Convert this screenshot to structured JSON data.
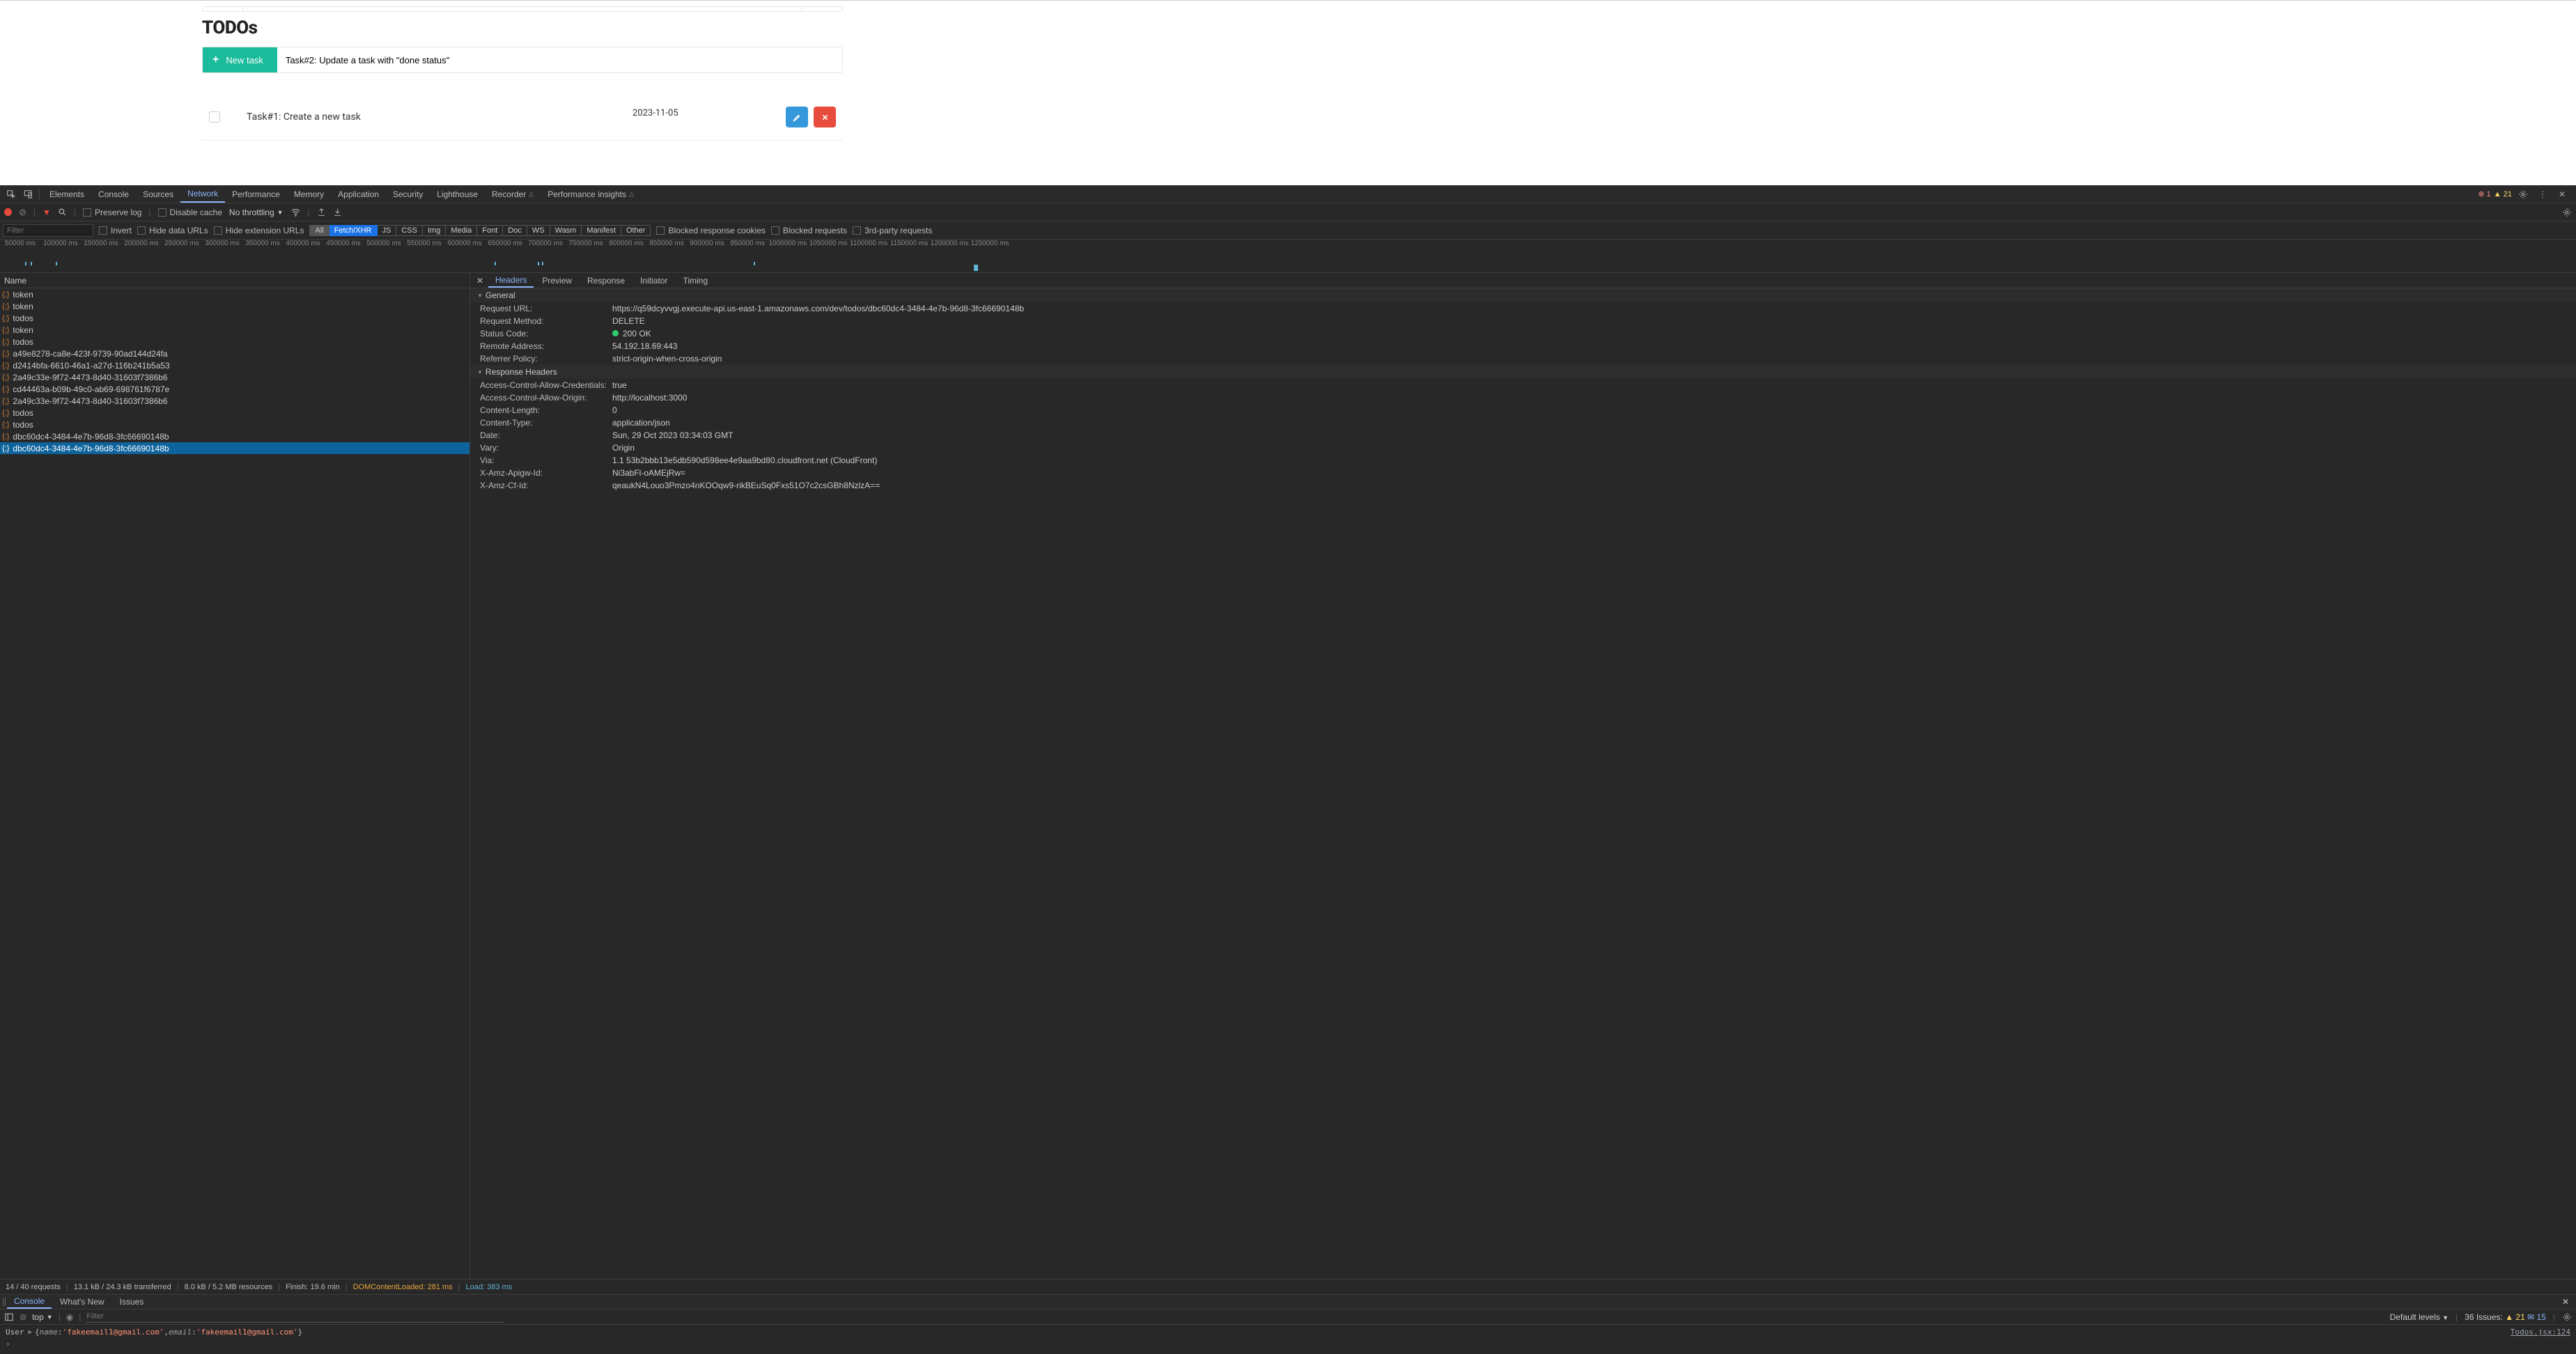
{
  "app": {
    "heading": "TODOs",
    "newTaskButton": "New task",
    "newTaskInput": "Task#2: Update a task with \"done status\"",
    "item": {
      "label": "Task#1: Create a new task",
      "date": "2023-11-05"
    }
  },
  "devtools": {
    "tabs": [
      "Elements",
      "Console",
      "Sources",
      "Network",
      "Performance",
      "Memory",
      "Application",
      "Security",
      "Lighthouse",
      "Recorder",
      "Performance insights"
    ],
    "activeTab": "Network",
    "errors": "1",
    "warnings": "21",
    "toolbar": {
      "preserveLog": "Preserve log",
      "disableCache": "Disable cache",
      "throttling": "No throttling"
    },
    "filterbar": {
      "filterPlaceholder": "Filter",
      "invert": "Invert",
      "hideDataUrls": "Hide data URLs",
      "hideExtensionUrls": "Hide extension URLs",
      "types": [
        "All",
        "Fetch/XHR",
        "JS",
        "CSS",
        "Img",
        "Media",
        "Font",
        "Doc",
        "WS",
        "Wasm",
        "Manifest",
        "Other"
      ],
      "blockedCookies": "Blocked response cookies",
      "blockedRequests": "Blocked requests",
      "thirdParty": "3rd-party requests"
    },
    "timeline": [
      "50000 ms",
      "100000 ms",
      "150000 ms",
      "200000 ms",
      "250000 ms",
      "300000 ms",
      "350000 ms",
      "400000 ms",
      "450000 ms",
      "500000 ms",
      "550000 ms",
      "600000 ms",
      "650000 ms",
      "700000 ms",
      "750000 ms",
      "800000 ms",
      "850000 ms",
      "900000 ms",
      "950000 ms",
      "1000000 ms",
      "1050000 ms",
      "1100000 ms",
      "1150000 ms",
      "1200000 ms",
      "1250000 ms"
    ],
    "nameHeader": "Name",
    "requests": [
      "token",
      "token",
      "todos",
      "token",
      "todos",
      "a49e8278-ca8e-423f-9739-90ad144d24fa",
      "d2414bfa-6610-46a1-a27d-116b241b5a53",
      "2a49c33e-9f72-4473-8d40-31603f7386b6",
      "cd44463a-b09b-49c0-ab69-698761f6787e",
      "2a49c33e-9f72-4473-8d40-31603f7386b6",
      "todos",
      "todos",
      "dbc60dc4-3484-4e7b-96d8-3fc66690148b",
      "dbc60dc4-3484-4e7b-96d8-3fc66690148b"
    ],
    "selectedIndex": 13,
    "detailTabs": [
      "Headers",
      "Preview",
      "Response",
      "Initiator",
      "Timing"
    ],
    "activeDetailTab": "Headers",
    "sections": {
      "general": "General",
      "responseHeaders": "Response Headers"
    },
    "general": {
      "url_k": "Request URL:",
      "url_v": "https://q59dcyvvgj.execute-api.us-east-1.amazonaws.com/dev/todos/dbc60dc4-3484-4e7b-96d8-3fc66690148b",
      "method_k": "Request Method:",
      "method_v": "DELETE",
      "status_k": "Status Code:",
      "status_v": "200 OK",
      "remote_k": "Remote Address:",
      "remote_v": "54.192.18.69:443",
      "referrer_k": "Referrer Policy:",
      "referrer_v": "strict-origin-when-cross-origin"
    },
    "responseHeaders": {
      "acac_k": "Access-Control-Allow-Credentials:",
      "acac_v": "true",
      "acao_k": "Access-Control-Allow-Origin:",
      "acao_v": "http://localhost:3000",
      "clen_k": "Content-Length:",
      "clen_v": "0",
      "ctype_k": "Content-Type:",
      "ctype_v": "application/json",
      "date_k": "Date:",
      "date_v": "Sun, 29 Oct 2023 03:34:03 GMT",
      "vary_k": "Vary:",
      "vary_v": "Origin",
      "via_k": "Via:",
      "via_v": "1.1 53b2bbb13e5db590d598ee4e9aa9bd80.cloudfront.net (CloudFront)",
      "apigw_k": "X-Amz-Apigw-Id:",
      "apigw_v": "Ni3abFl-oAMEjRw=",
      "cfid_k": "X-Amz-Cf-Id:",
      "cfid_v": "qeaukN4Louo3Pmzo4nKOOqw9-rikBEuSq0Fxs51O7c2csGBh8NzlzA=="
    },
    "footer": {
      "requests": "14 / 40 requests",
      "transferred": "13.1 kB / 24.3 kB transferred",
      "resources": "8.0 kB / 5.2 MB resources",
      "finish": "Finish: 19.6 min",
      "dcl": "DOMContentLoaded: 281 ms",
      "load": "Load: 383 ms"
    },
    "drawer": {
      "tabs": [
        "Console",
        "What's New",
        "Issues"
      ],
      "active": "Console"
    },
    "consoleBar": {
      "context": "top",
      "filterPlaceholder": "Filter",
      "levels": "Default levels",
      "issues": "36 Issues:",
      "issuesWarn": "21",
      "issuesInfo": "15"
    },
    "consoleLog": {
      "label": "User",
      "name_k": "name",
      "name_v": "'fakeemail1@gmail.com'",
      "email_k": "email",
      "email_v": "'fakeemail1@gmail.com'",
      "src": "Todos.jsx:124"
    }
  }
}
